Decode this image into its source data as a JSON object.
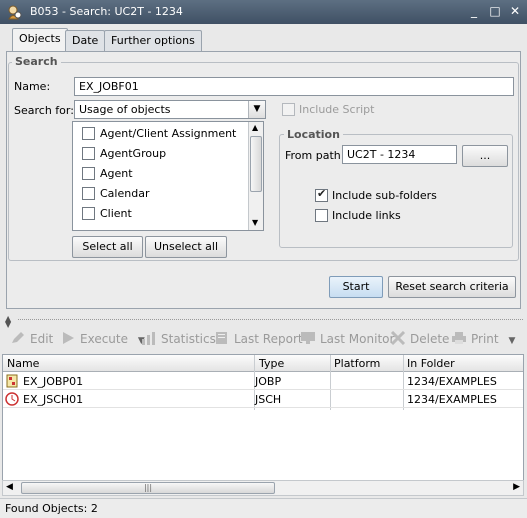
{
  "window": {
    "title": "B053 - Search: UC2T - 1234",
    "buttons": [
      "_",
      "□",
      "✕"
    ]
  },
  "tabs": [
    {
      "label": "Objects",
      "active": true
    },
    {
      "label": "Date",
      "active": false
    },
    {
      "label": "Further options",
      "active": false
    }
  ],
  "search": {
    "group_label": "Search",
    "name_label": "Name:",
    "name_value": "EX_JOBF01",
    "search_for_label": "Search for:",
    "search_for_value": "Usage of objects",
    "include_script_label": "Include Script",
    "include_script_checked": false,
    "object_types": [
      {
        "label": "Agent/Client  Assignment",
        "checked": false
      },
      {
        "label": "AgentGroup",
        "checked": false
      },
      {
        "label": "Agent",
        "checked": false
      },
      {
        "label": "Calendar",
        "checked": false
      },
      {
        "label": "Client",
        "checked": false
      }
    ],
    "select_all": "Select all",
    "unselect_all": "Unselect all"
  },
  "location": {
    "group_label": "Location",
    "from_path_label": "From path:",
    "from_path_value": "UC2T - 1234",
    "browse_label": "...",
    "include_subfolders_label": "Include sub-folders",
    "include_subfolders_checked": true,
    "include_links_label": "Include links",
    "include_links_checked": false
  },
  "actions": {
    "start": "Start",
    "reset": "Reset search criteria"
  },
  "toolbar": {
    "edit": "Edit",
    "execute": "Execute",
    "statistics": "Statistics",
    "last_report": "Last Report",
    "last_monitor": "Last Monitor",
    "delete": "Delete",
    "print": "Print"
  },
  "results": {
    "columns": [
      "Name",
      "Type",
      "Platform",
      "In Folder"
    ],
    "rows": [
      {
        "name": "EX_JOBP01",
        "type": "JOBP",
        "platform": "",
        "folder": "1234/EXAMPLES",
        "icon": "workflow-icon"
      },
      {
        "name": "EX_JSCH01",
        "type": "JSCH",
        "platform": "",
        "folder": "1234/EXAMPLES",
        "icon": "schedule-icon"
      }
    ]
  },
  "status": {
    "found": "Found Objects: 2"
  }
}
